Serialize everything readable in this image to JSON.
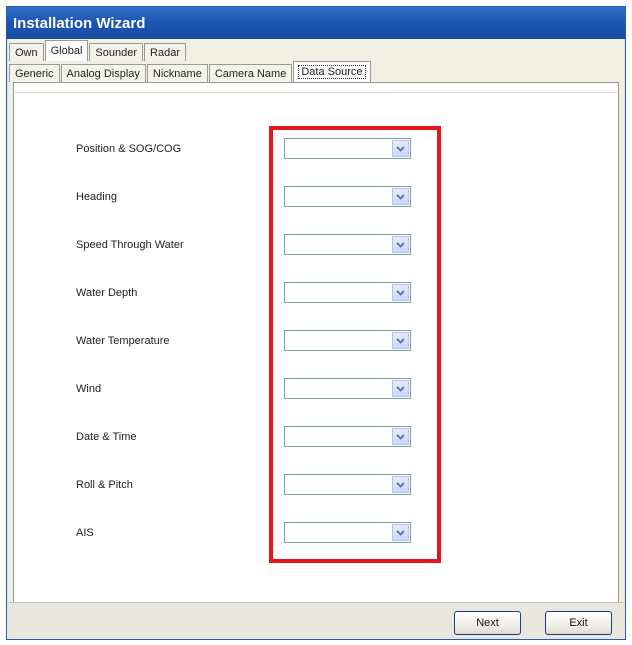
{
  "window": {
    "title": "Installation Wizard"
  },
  "top_tabs": [
    {
      "label": "Own",
      "active": false
    },
    {
      "label": "Global",
      "active": true
    },
    {
      "label": "Sounder",
      "active": false
    },
    {
      "label": "Radar",
      "active": false
    }
  ],
  "sub_tabs": [
    {
      "label": "Generic",
      "active": false
    },
    {
      "label": "Analog Display",
      "active": false
    },
    {
      "label": "Nickname",
      "active": false
    },
    {
      "label": "Camera Name",
      "active": false
    },
    {
      "label": "Data Source",
      "active": true
    }
  ],
  "data_source": {
    "fields": [
      {
        "label": "Position & SOG/COG",
        "value": ""
      },
      {
        "label": "Heading",
        "value": ""
      },
      {
        "label": "Speed Through Water",
        "value": ""
      },
      {
        "label": "Water Depth",
        "value": ""
      },
      {
        "label": "Water Temperature",
        "value": ""
      },
      {
        "label": "Wind",
        "value": ""
      },
      {
        "label": "Date & Time",
        "value": ""
      },
      {
        "label": "Roll & Pitch",
        "value": ""
      },
      {
        "label": "AIS",
        "value": ""
      }
    ]
  },
  "footer": {
    "next_label": "Next",
    "exit_label": "Exit"
  },
  "colors": {
    "title_bar": "#1e57b2",
    "highlight": "#e2161c",
    "combo_arrow": "#4d6fb5"
  },
  "icons": {
    "combo_arrow": "chevron-down-icon"
  }
}
